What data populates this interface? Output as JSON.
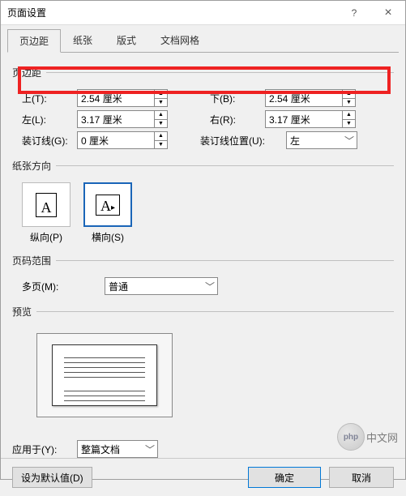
{
  "window": {
    "title": "页面设置",
    "help": "?",
    "close": "×"
  },
  "tabs": [
    "页边距",
    "纸张",
    "版式",
    "文档网格"
  ],
  "selected_tab": 0,
  "margins": {
    "legend": "页边距",
    "top_label": "上(T):",
    "top_value": "2.54 厘米",
    "bottom_label": "下(B):",
    "bottom_value": "2.54 厘米",
    "left_label": "左(L):",
    "left_value": "3.17 厘米",
    "right_label": "右(R):",
    "right_value": "3.17 厘米",
    "gutter_label": "装订线(G):",
    "gutter_value": "0 厘米",
    "gutter_pos_label": "装订线位置(U):",
    "gutter_pos_value": "左"
  },
  "orientation": {
    "legend": "纸张方向",
    "portrait": "纵向(P)",
    "landscape": "横向(S)",
    "selected": "landscape"
  },
  "page_range": {
    "legend": "页码范围",
    "multi_label": "多页(M):",
    "multi_value": "普通"
  },
  "preview": {
    "legend": "预览"
  },
  "apply": {
    "label": "应用于(Y):",
    "value": "整篇文档"
  },
  "buttons": {
    "set_default": "设为默认值(D)",
    "ok": "确定",
    "cancel": "取消"
  },
  "watermark": {
    "badge": "php",
    "text": "中文网"
  }
}
